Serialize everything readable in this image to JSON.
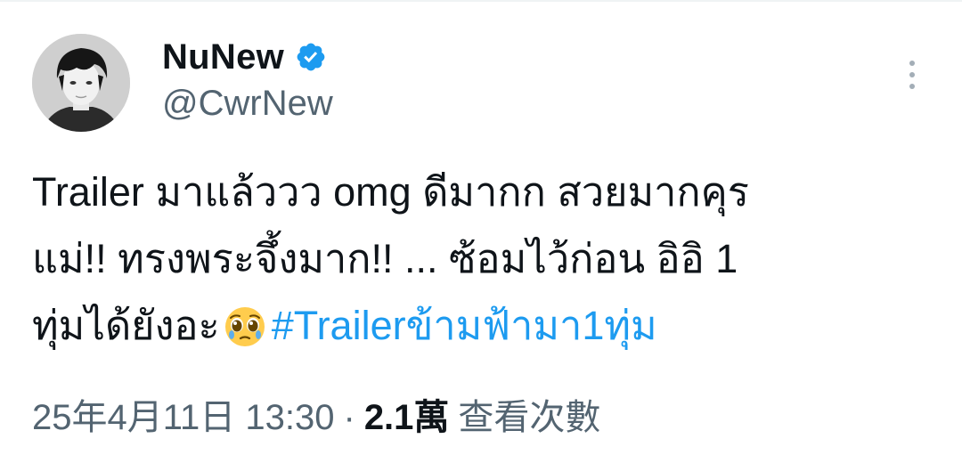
{
  "author": {
    "display_name": "NuNew",
    "handle": "@CwrNew",
    "verified_icon": "verified-badge-icon",
    "avatar_icon": "profile-photo"
  },
  "menu": {
    "icon": "more-vertical-icon"
  },
  "tweet": {
    "line1": "Trailer มาแล้ววว omg ดีมากก สวยมากคุร",
    "line2": "แม่!! ทรงพระจึ้งมาก!! ... ซ้อมไว้ก่อน อิอิ 1",
    "line3_text": "ทุ่มได้ยังอะ",
    "emoji": "pleading-face-emoji",
    "hashtag": "#Trailerข้ามฟ้ามา1ทุ่ม"
  },
  "meta": {
    "timestamp": "25年4月11日 13:30",
    "separator": "·",
    "views_count": "2.1萬",
    "views_label": "查看次數"
  },
  "colors": {
    "link": "#1d9bf0",
    "secondary_text": "#536471",
    "primary_text": "#0f1419"
  }
}
